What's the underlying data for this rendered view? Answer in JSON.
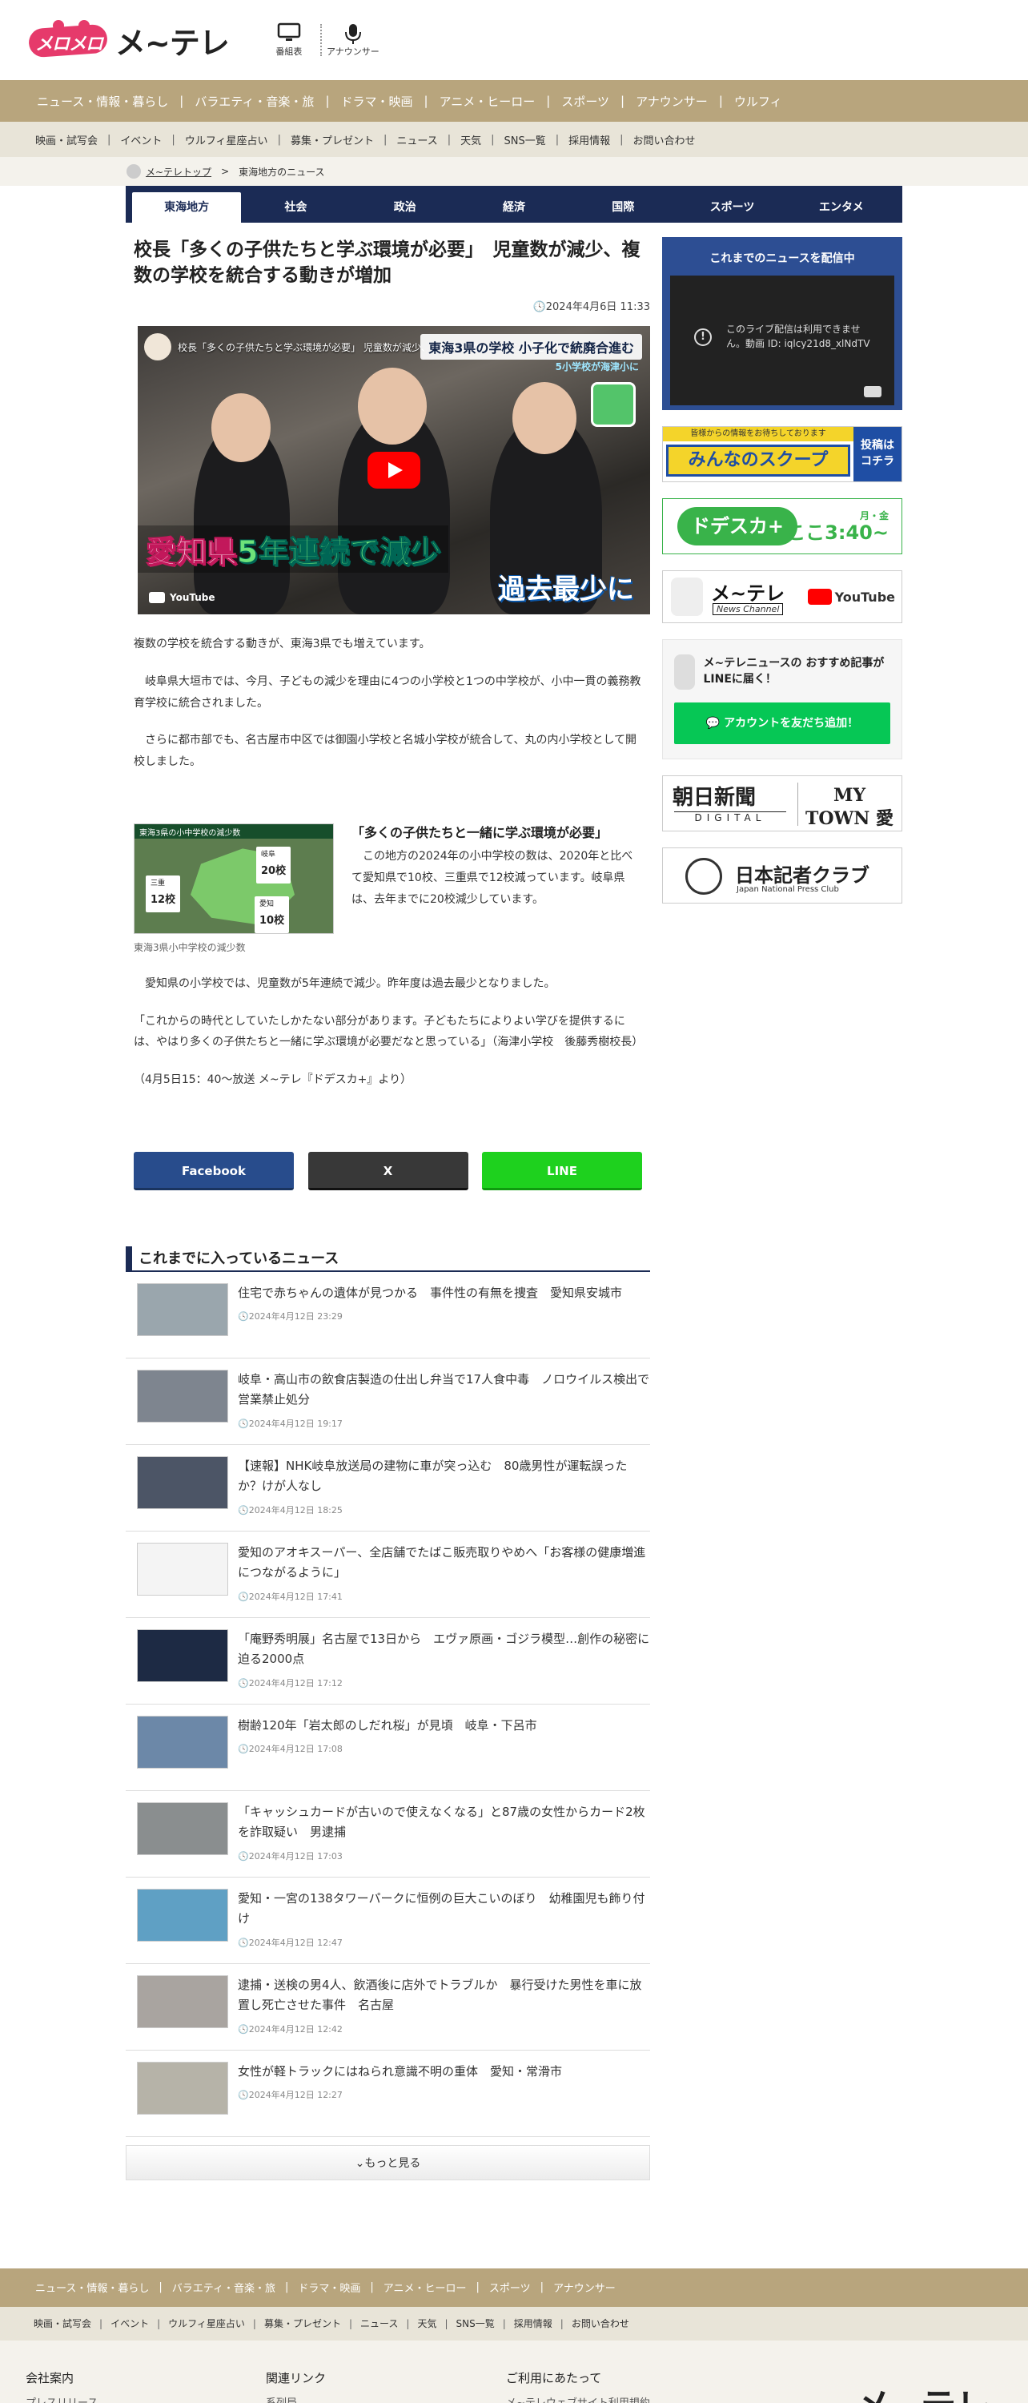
{
  "header": {
    "logo_mascot": "メ~テレ ロゴ",
    "logo_text": "メ~テレ",
    "icons": [
      {
        "label": "番組表",
        "icon": "tv-icon"
      },
      {
        "label": "アナウンサー",
        "icon": "microphone-icon"
      }
    ]
  },
  "nav_main": [
    "ニュース・情報・暮らし",
    "バラエティ・音楽・旅",
    "ドラマ・映画",
    "アニメ・ヒーロー",
    "スポーツ",
    "アナウンサー",
    "ウルフィ"
  ],
  "nav_sub": [
    "映画・試写会",
    "イベント",
    "ウルフィ星座占い",
    "募集・プレゼント",
    "ニュース",
    "天気",
    "SNS一覧",
    "採用情報",
    "お問い合わせ"
  ],
  "breadcrumb": {
    "home": "メ~テレトップ",
    "separator": ">",
    "current": "東海地方のニュース"
  },
  "category_tabs": [
    "東海地方",
    "社会",
    "政治",
    "経済",
    "国際",
    "スポーツ",
    "エンタメ"
  ],
  "article": {
    "title": "校長「多くの子供たちと学ぶ環境が必要」　児童数が減少、複数の学校を統合する動きが増加",
    "date": "2024年4月6日 11:33",
    "video": {
      "title": "校長「多くの子供たちと学ぶ環境が必要」 児童数が減少、複数の学校を統合する動きが増加",
      "banner": "東海3県の学校 小子化で統廃合進む",
      "banner_sub": "5小学校が海津小に",
      "caption_main_1": "愛知県",
      "caption_main_2": "5年連続で",
      "caption_main_3": "減少",
      "caption_bottom": "過去最少に",
      "yt_label": "YouTube"
    },
    "lead": "複数の学校を統合する動きが、東海3県でも増えています。",
    "p1": "岐阜県大垣市では、今月、子どもの減少を理由に4つの小学校と1つの中学校が、小中一貫の義務教育学校に統合されました。",
    "p2": "さらに都市部でも、名古屋市中区では御園小学校と名城小学校が統合して、丸の内小学校として開校しました。",
    "inline": {
      "map_header": "東海3県の小中学校の減少数",
      "tag_gifu_label": "岐阜",
      "tag_gifu": "20校",
      "tag_mie_label": "三重",
      "tag_mie": "12校",
      "tag_aichi_label": "愛知",
      "tag_aichi": "10校",
      "caption": "東海3県小中学校の減少数",
      "heading": "「多くの子供たちと一緒に学ぶ環境が必要」",
      "text": "この地方の2024年の小中学校の数は、2020年と比べて愛知県で10校、三重県で12校減っています。岐阜県は、去年までに20校減少しています。"
    },
    "p3": "愛知県の小学校では、児童数が5年連続で減少。昨年度は過去最少となりました。",
    "p4": "「これからの時代としていたしかたない部分があります。子どもたちによりよい学びを提供するには、やはり多くの子供たちと一緒に学ぶ環境が必要だなと思っている」（海津小学校　後藤秀樹校長）",
    "p5": "（4月5日15：40～放送 メ~テレ『ドデスカ+』より）"
  },
  "share": {
    "facebook": "Facebook",
    "x": "X",
    "line": "LINE"
  },
  "past_news": {
    "heading": "これまでに入っているニュース",
    "items": [
      {
        "title": "住宅で赤ちゃんの遺体が見つかる　事件性の有無を捜査　愛知県安城市",
        "date": "2024年4月12日 23:29",
        "thumb": "#9aa6ad"
      },
      {
        "title": "岐阜・高山市の飲食店製造の仕出し弁当で17人食中毒　ノロウイルス検出で営業禁止処分",
        "date": "2024年4月12日 19:17",
        "thumb": "#7e858f"
      },
      {
        "title": "【速報】NHK岐阜放送局の建物に車が突っ込む　80歳男性が運転誤ったか？けが人なし",
        "date": "2024年4月12日 18:25",
        "thumb": "#4c5566"
      },
      {
        "title": "愛知のアオキスーパー、全店舗でたばこ販売取りやめへ「お客様の健康増進につながるように」",
        "date": "2024年4月12日 17:41",
        "thumb": "#f4f4f4"
      },
      {
        "title": "「庵野秀明展」名古屋で13日から　エヴァ原画・ゴジラ模型…創作の秘密に迫る2000点",
        "date": "2024年4月12日 17:12",
        "thumb": "#1d2a44"
      },
      {
        "title": "樹齢120年「岩太郎のしだれ桜」が見頃　岐阜・下呂市",
        "date": "2024年4月12日 17:08",
        "thumb": "#6c88a8"
      },
      {
        "title": "「キャッシュカードが古いので使えなくなる」と87歳の女性からカード2枚を詐取疑い　男逮捕",
        "date": "2024年4月12日 17:03",
        "thumb": "#8a8e8f"
      },
      {
        "title": "愛知・一宮の138タワーパークに恒例の巨大こいのぼり　幼稚園児も飾り付け",
        "date": "2024年4月12日 12:47",
        "thumb": "#5fa0c4"
      },
      {
        "title": "逮捕・送検の男4人、飲酒後に店外でトラブルか　暴行受けた男性を車に放置し死亡させた事件　名古屋",
        "date": "2024年4月12日 12:42",
        "thumb": "#a9a4a0"
      },
      {
        "title": "女性が軽トラックにはねられ意識不明の重体　愛知・常滑市",
        "date": "2024年4月12日 12:27",
        "thumb": "#b6b3a8"
      }
    ],
    "more": "もっと見る"
  },
  "side": {
    "live_heading": "これまでのニュースを配信中",
    "live_error": "このライブ配信は利用できません。動画 ID: iqlcy21d8_xlNdTV",
    "scoop_top": "皆様からの情報をお待ちしております",
    "scoop_main": "みんなのスクープ",
    "scoop_right": "投稿は コチラ",
    "dosu_logo": "ドデスカ+",
    "dosu_days": "月・金",
    "dosu_time": "ここ3:40~",
    "ytc_title": "メ~テレ",
    "ytc_sub": "News Channel",
    "ytc_yt": "YouTube",
    "line_text": "メ~テレニュースの おすすめ記事がLINEに届く！",
    "line_btn": "アカウントを友だち追加！",
    "asahi_l": "朝日新聞",
    "asahi_d": "DIGITAL",
    "asahi_r": "MY TOWN 愛知",
    "jnpc_t": "日本記者クラブ",
    "jnpc_s": "Japan National Press Club"
  },
  "footer": {
    "nav": [
      "ニュース・情報・暮らし",
      "バラエティ・音楽・旅",
      "ドラマ・映画",
      "アニメ・ヒーロー",
      "スポーツ",
      "アナウンサー"
    ],
    "sub": [
      "映画・試写会",
      "イベント",
      "ウルフィ星座占い",
      "募集・プレゼント",
      "ニュース",
      "天気",
      "SNS一覧",
      "採用情報",
      "お問い合わせ"
    ],
    "cols": [
      {
        "h": "会社案内",
        "i": "プレスリリース"
      },
      {
        "h": "関連リンク",
        "i": "系列局"
      },
      {
        "h": "ご利用にあたって",
        "i": "メ~テレウェブサイト利用規約"
      }
    ],
    "logo": "メ~テレ"
  }
}
